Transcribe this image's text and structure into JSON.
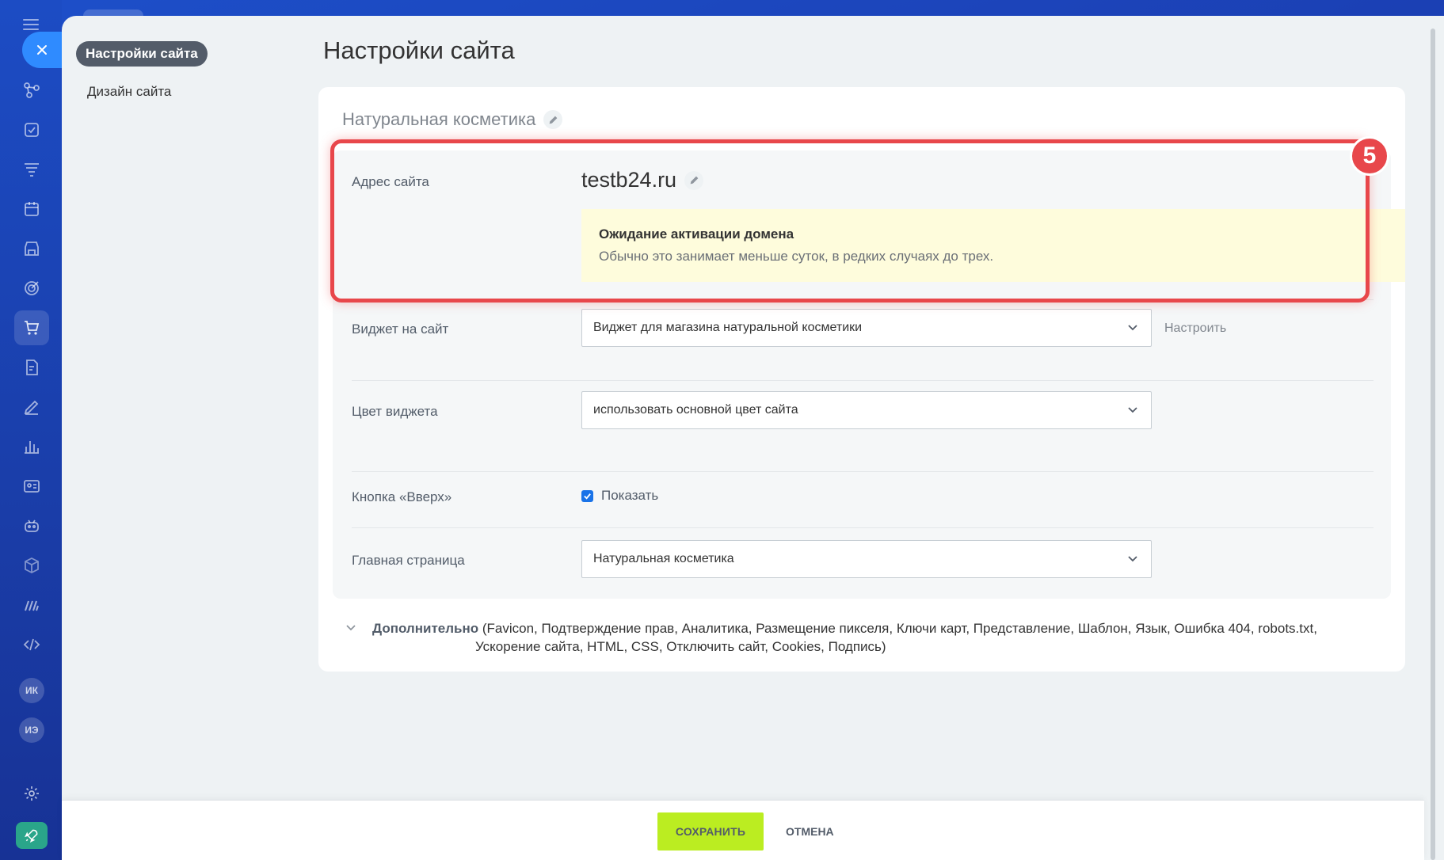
{
  "left_nav": {
    "active_item": "Настройки сайта",
    "items": [
      "Дизайн сайта"
    ]
  },
  "page": {
    "title": "Настройки сайта"
  },
  "site": {
    "name": "Натуральная косметика",
    "address_label": "Адрес сайта",
    "address": "testb24.ru",
    "notice_title": "Ожидание активации домена",
    "notice_text": "Обычно это занимает меньше суток, в редких случаях до трех."
  },
  "fields": {
    "widget_label": "Виджет на сайт",
    "widget_value": "Виджет для магазина натуральной косметики",
    "widget_configure": "Настроить",
    "widget_color_label": "Цвет виджета",
    "widget_color_value": "использовать основной цвет сайта",
    "up_button_label": "Кнопка «Вверх»",
    "up_button_checkbox": "Показать",
    "home_page_label": "Главная страница",
    "home_page_value": "Натуральная косметика"
  },
  "extra": {
    "label": "Дополнительно",
    "items_line1": "(Favicon,  Подтверждение прав,  Аналитика,  Размещение пикселя,  Ключи карт,  Представление,  Шаблон,  Язык,  Ошибка 404,  robots.txt,",
    "items_line2": "Ускорение сайта,  HTML,  CSS,  Отключить сайт,  Cookies,  Подпись)"
  },
  "annotation": {
    "step": "5",
    "color": "#e8474b"
  },
  "footer": {
    "save_label": "СОХРАНИТЬ",
    "cancel_label": "ОТМЕНА"
  },
  "rail": {
    "avatars": [
      "ИК",
      "ИЭ"
    ]
  },
  "colors": {
    "save_button": "#bbed21",
    "notice_bg": "#fefcdc",
    "checkbox": "#1a73e8"
  }
}
